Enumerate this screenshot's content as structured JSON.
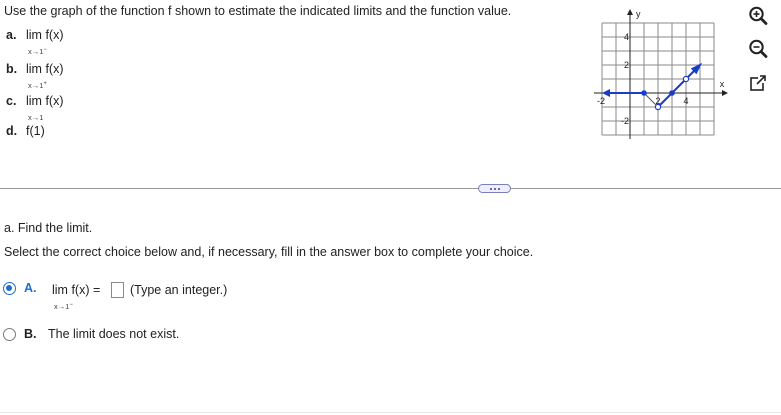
{
  "question": {
    "prompt": "Use the graph of the function f shown to estimate the indicated limits and the function value.",
    "parts": [
      {
        "letter": "a.",
        "expr": "lim f(x)",
        "sub_base": "x→1",
        "sub_sup": "−"
      },
      {
        "letter": "b.",
        "expr": "lim f(x)",
        "sub_base": "x→1",
        "sub_sup": "+"
      },
      {
        "letter": "c.",
        "expr": "lim f(x)",
        "sub_base": "x→1",
        "sub_sup": ""
      },
      {
        "letter": "d.",
        "expr": "f(1)"
      }
    ]
  },
  "graph": {
    "x_axis_label": "x",
    "y_axis_label": "y",
    "x_tick_labels": [
      "-2",
      "2",
      "4"
    ],
    "y_tick_labels": [
      "4",
      "2",
      "-2"
    ],
    "x_range": [
      -2,
      6
    ],
    "y_range": [
      -3,
      5
    ],
    "curve_color": "#1a3dc8",
    "curve": {
      "left_ray": {
        "from": [
          1,
          0
        ],
        "to": [
          -2,
          0
        ],
        "arrow": true
      },
      "segment_down": {
        "from": [
          1,
          0
        ],
        "to": [
          2,
          -1
        ]
      },
      "segment_up": [
        [
          2,
          -1
        ],
        [
          3,
          0
        ],
        [
          4,
          1
        ],
        [
          5,
          2
        ]
      ],
      "open_points": [
        [
          2,
          -1
        ],
        [
          4,
          1
        ]
      ],
      "closed_points": [
        [
          1,
          0
        ],
        [
          3,
          0
        ]
      ]
    }
  },
  "tools": {
    "zoom_in": "zoom-in-icon",
    "zoom_out": "zoom-out-icon",
    "expand": "expand-icon"
  },
  "answer_section": {
    "part_title": "a. Find the limit.",
    "instruction": "Select the correct choice below and, if necessary, fill in the answer box to complete your choice.",
    "choice_a": {
      "letter": "A.",
      "expr": "lim f(x) =",
      "sub_base": "x→1",
      "sub_sup": "−",
      "hint": "(Type an integer.)",
      "answer_value": "",
      "selected": true
    },
    "choice_b": {
      "letter": "B.",
      "text": "The limit does not exist.",
      "selected": false
    }
  },
  "colors": {
    "accent": "#1f6fd0",
    "curve": "#1a3dc8",
    "divider": "#9a9a9a"
  }
}
